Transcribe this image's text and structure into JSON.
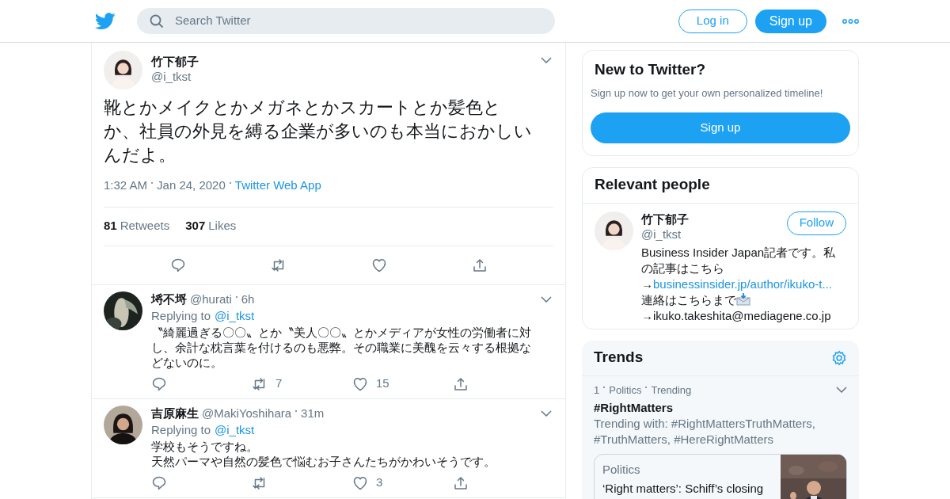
{
  "header": {
    "search_placeholder": "Search Twitter",
    "login": "Log in",
    "signup": "Sign up"
  },
  "tweet": {
    "name": "竹下郁子",
    "handle": "@i_tkst",
    "text": "靴とかメイクとかメガネとかスカートとか髪色とか、社員の外見を縛る企業が多いのも本当におかしいんだよ。",
    "time": "1:32 AM",
    "date": "Jan 24, 2020",
    "source": "Twitter Web App",
    "stats": [
      {
        "count": "81",
        "label": "Retweets"
      },
      {
        "count": "307",
        "label": "Likes"
      }
    ]
  },
  "replies": [
    {
      "name": "埓不埒",
      "handle": "@hurati",
      "time": "6h",
      "replying_label": "Replying to",
      "replying_to": "@i_tkst",
      "lines": [
        "〝綺麗過ぎる〇〇〟とか〝美人〇〇〟とかメディアが女性の労働者に対し、余計な枕言葉を付けるのも悪弊。その職業に美醜を云々する根拠などないのに。"
      ],
      "actions": [
        {
          "kind": "reply"
        },
        {
          "kind": "retweet",
          "count": "7"
        },
        {
          "kind": "like",
          "count": "15"
        },
        {
          "kind": "share"
        }
      ]
    },
    {
      "name": "吉原麻生",
      "handle": "@MakiYoshihara",
      "time": "31m",
      "replying_label": "Replying to",
      "replying_to": "@i_tkst",
      "lines": [
        "学校もそうですね。",
        "天然パーマや自然の髪色で悩むお子さんたちがかわいそうです。"
      ],
      "actions": [
        {
          "kind": "reply"
        },
        {
          "kind": "retweet"
        },
        {
          "kind": "like",
          "count": "3"
        },
        {
          "kind": "share"
        }
      ]
    }
  ],
  "new_to_twitter": {
    "title": "New to Twitter?",
    "subtitle": "Sign up now to get your own personalized timeline!",
    "button": "Sign up"
  },
  "relevant_people": {
    "title": "Relevant people",
    "person": {
      "name": "竹下郁子",
      "handle": "@i_tkst",
      "follow": "Follow",
      "bio_start": "Business Insider Japan記者です。私の記事はこちら→",
      "bio_link": "businessinsider.jp/author/ikuko-t...",
      "bio_middle": "連絡はこちらまで",
      "bio_end": "→ikuko.takeshita@mediagene.co.jp"
    }
  },
  "trends": {
    "title": "Trends",
    "items": [
      {
        "rank": "1",
        "category": "Politics",
        "status": "Trending",
        "name": "#RightMatters",
        "trending_with": "Trending with: #RightMattersTruthMatters, #TruthMatters, #HereRightMatters",
        "news": {
          "category": "Politics",
          "headline": "‘Right matters’: Schiff’s closing",
          "kind": "picture"
        }
      }
    ]
  }
}
